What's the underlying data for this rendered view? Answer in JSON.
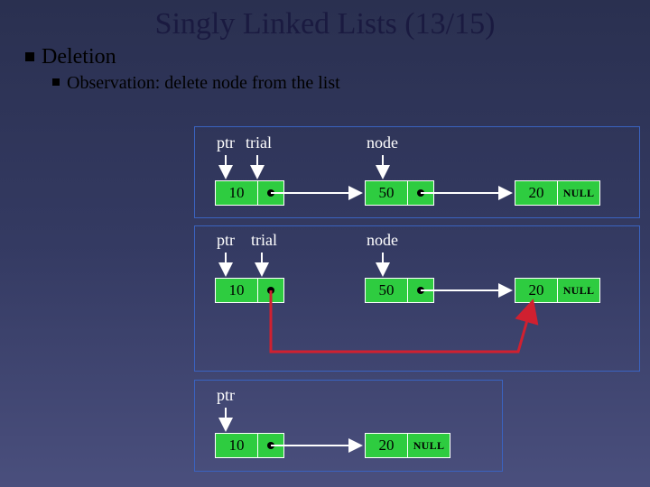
{
  "title": "Singly Linked Lists (13/15)",
  "bullet1": "Deletion",
  "bullet2": "Observation: delete node from the list",
  "labels": {
    "ptr1": "ptr",
    "trial1": "trial",
    "node1": "node",
    "ptr2": "ptr",
    "trial2": "trial",
    "node2": "node",
    "ptr3": "ptr"
  },
  "nodes": {
    "r1a": "10",
    "r1b": "50",
    "r1c": "20",
    "r1null": "NULL",
    "r2a": "10",
    "r2b": "50",
    "r2c": "20",
    "r2null": "NULL",
    "r3a": "10",
    "r3b": "20",
    "r3null": "NULL"
  }
}
